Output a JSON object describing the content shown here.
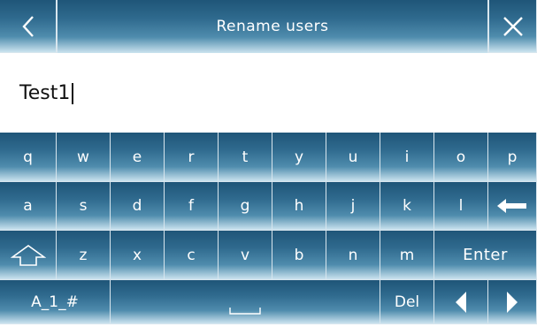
{
  "header": {
    "title": "Rename users",
    "back_icon": "chevron-left-icon",
    "close_icon": "close-icon"
  },
  "input": {
    "value": "Test1"
  },
  "keyboard": {
    "row1": [
      "q",
      "w",
      "e",
      "r",
      "t",
      "y",
      "u",
      "i",
      "o",
      "p"
    ],
    "row2": [
      "a",
      "s",
      "d",
      "f",
      "g",
      "h",
      "j",
      "k",
      "l"
    ],
    "row2_backspace_icon": "backspace-arrow-icon",
    "row3_shift_icon": "shift-arrow-icon",
    "row3": [
      "z",
      "x",
      "c",
      "v",
      "b",
      "n",
      "m"
    ],
    "enter_label": "Enter",
    "symbols_label": "A_1_#",
    "space_label": "␣",
    "del_label": "Del",
    "left_icon": "triangle-left-icon",
    "right_icon": "triangle-right-icon"
  },
  "colors": {
    "button_top": "#1f5578",
    "button_bottom": "#cbe3ef",
    "text": "#ffffff"
  }
}
